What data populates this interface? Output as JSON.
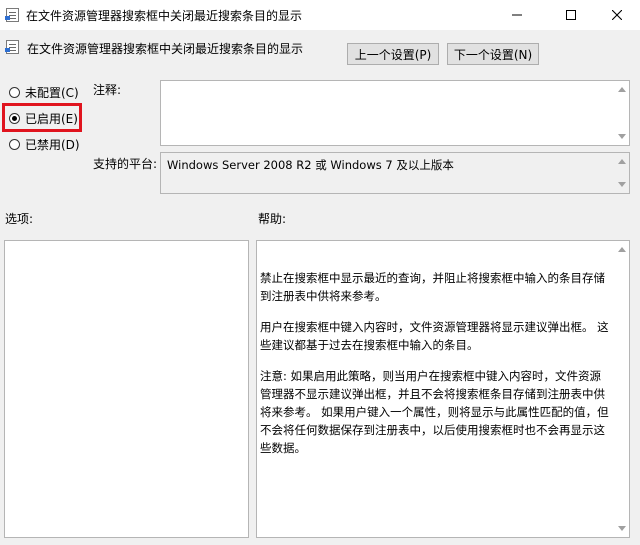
{
  "window": {
    "title": "在文件资源管理器搜索框中关闭最近搜索条目的显示",
    "controls": [
      "minimize",
      "maximize",
      "close"
    ]
  },
  "header": {
    "policy_name": "在文件资源管理器搜索框中关闭最近搜索条目的显示",
    "prev_button": "上一个设置(P)",
    "next_button": "下一个设置(N)"
  },
  "state_options": [
    {
      "label": "未配置(C)",
      "checked": false
    },
    {
      "label": "已启用(E)",
      "checked": true
    },
    {
      "label": "已禁用(D)",
      "checked": false
    }
  ],
  "comment": {
    "label": "注释:",
    "value": ""
  },
  "supported": {
    "label": "支持的平台:",
    "value": "Windows Server 2008 R2 或 Windows 7 及以上版本"
  },
  "options": {
    "label": "选项:"
  },
  "help": {
    "label": "帮助:",
    "paragraphs": [
      "禁止在搜索框中显示最近的查询，并阻止将搜索框中输入的条目存储到注册表中供将来参考。",
      "用户在搜索框中键入内容时，文件资源管理器将显示建议弹出框。 这些建议都基于过去在搜索框中输入的条目。",
      "注意: 如果启用此策略，则当用户在搜索框中键入内容时，文件资源管理器不显示建议弹出框，并且不会将搜索框条目存储到注册表中供将来参考。 如果用户键入一个属性，则将显示与此属性匹配的值，但不会将任何数据保存到注册表中，以后使用搜索框时也不会再显示这些数据。"
    ]
  },
  "colors": {
    "highlight": "#e0141e",
    "window_bg": "#f0f0f0"
  }
}
